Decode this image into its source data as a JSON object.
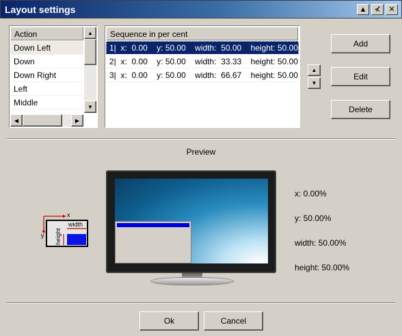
{
  "window": {
    "title": "Layout settings",
    "controls": {
      "minimize": "▲",
      "pin": "⊀",
      "close": "✕"
    }
  },
  "action_list": {
    "header": "Action",
    "items": [
      "Down Left",
      "Down",
      "Down Right",
      "Left",
      "Middle"
    ]
  },
  "sequence_list": {
    "header": "Sequence in per cent",
    "items": [
      "1|  x:  0.00    y: 50.00    width:  50.00    height: 50.00",
      "2|  x:  0.00    y: 50.00    width:  33.33    height: 50.00",
      "3|  x:  0.00    y: 50.00    width:  66.67    height: 50.00"
    ]
  },
  "buttons": {
    "add": "Add",
    "edit": "Edit",
    "delete": "Delete",
    "ok": "Ok",
    "cancel": "Cancel"
  },
  "preview": {
    "label": "Preview",
    "x": "x: 0.00%",
    "y": "y: 50.00%",
    "width": "width: 50.00%",
    "height": "height: 50.00%"
  },
  "diagram": {
    "x_label": "x",
    "y_label": "y",
    "width_label": "width",
    "height_label": "height"
  },
  "colors": {
    "selection": "#0a246a",
    "accent_blue": "#0000dd",
    "arrow_red": "#cc0000"
  }
}
